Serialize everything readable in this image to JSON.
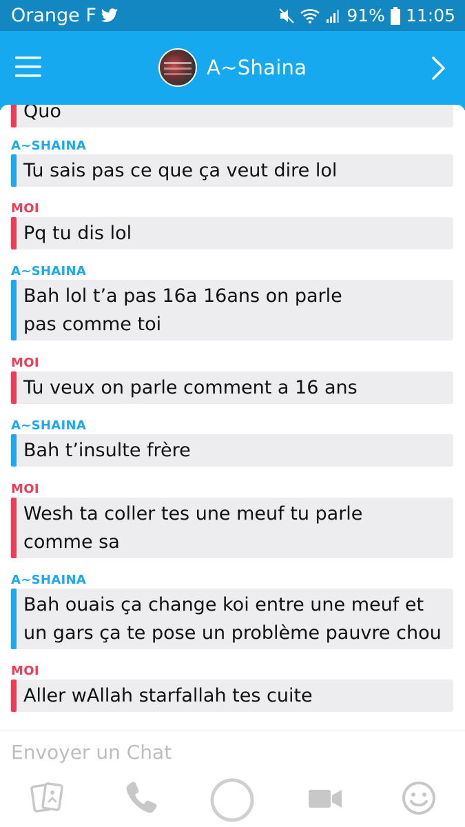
{
  "status_bar": {
    "carrier": "Orange F",
    "battery": "91%",
    "time": "11:05",
    "icons": [
      "twitter-icon",
      "mute-icon",
      "wifi-icon",
      "signal-icon",
      "battery-icon"
    ]
  },
  "header": {
    "contact_name": "A~Shaina",
    "icons": [
      "menu-icon",
      "avatar",
      "chevron-right-icon"
    ]
  },
  "messages": [
    {
      "sender": "",
      "text": "Quo",
      "from": "me"
    },
    {
      "sender": "A~SHAINA",
      "text": "Tu sais pas ce que ça veut dire lol",
      "from": "them"
    },
    {
      "sender": "MOI",
      "text": "Pq tu dis lol",
      "from": "me"
    },
    {
      "sender": "A~SHAINA",
      "lines": [
        "Bah lol t’a pas 16a 16ans on parle",
        "pas comme toi"
      ],
      "from": "them"
    },
    {
      "sender": "MOI",
      "text": "Tu veux on parle comment a 16 ans",
      "from": "me"
    },
    {
      "sender": "A~SHAINA",
      "text": "Bah t’insulte frère",
      "from": "them"
    },
    {
      "sender": "MOI",
      "lines": [
        "Wesh ta coller tes une meuf tu parle",
        "comme sa"
      ],
      "from": "me"
    },
    {
      "sender": "A~SHAINA",
      "lines": [
        "Bah ouais ça change koi entre une meuf et",
        "un gars ça te pose un problème pauvre chou"
      ],
      "from": "them"
    },
    {
      "sender": "MOI",
      "text": "Aller wAllah starfallah tes cuite",
      "from": "me"
    }
  ],
  "input": {
    "placeholder": "Envoyer un Chat"
  },
  "bottom_bar": {
    "icons": [
      "sticker-cards-icon",
      "phone-icon",
      "capture-button",
      "video-camera-icon",
      "emoji-icon"
    ]
  },
  "colors": {
    "status_bar": "#1287c2",
    "header": "#16a9ef",
    "them_accent": "#1ca9ef",
    "me_accent": "#f23c57",
    "bubble_bg": "#ededf0",
    "icon_gray": "#c8c8c8"
  }
}
